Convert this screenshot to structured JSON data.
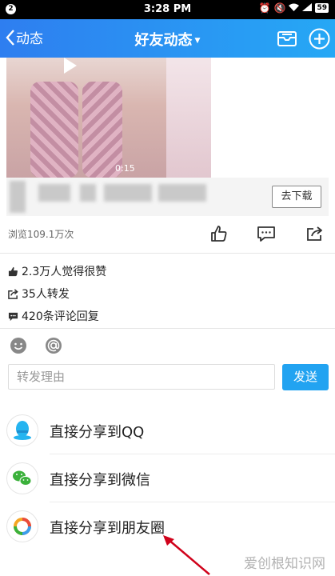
{
  "statusbar": {
    "notification_count": "2",
    "time": "3:28 PM",
    "battery": "59"
  },
  "header": {
    "back_label": "动态",
    "title": "好友动态"
  },
  "video": {
    "duration": "0:15"
  },
  "download_label": "去下载",
  "views_text": "浏览109.1万次",
  "stats": {
    "likes": "2.3万人觉得很赞",
    "shares": "35人转发",
    "comments": "420条评论回复"
  },
  "forward": {
    "placeholder": "转发理由",
    "send_label": "发送"
  },
  "share_options": [
    {
      "label": "直接分享到QQ",
      "icon": "qq-icon"
    },
    {
      "label": "直接分享到微信",
      "icon": "wechat-icon"
    },
    {
      "label": "直接分享到朋友圈",
      "icon": "moments-icon"
    }
  ],
  "watermark": "爱创根知识网",
  "colors": {
    "header_start": "#2e7ef0",
    "header_end": "#26a8f5",
    "send_button": "#22a3f1",
    "annotation_arrow": "#d0021b"
  }
}
